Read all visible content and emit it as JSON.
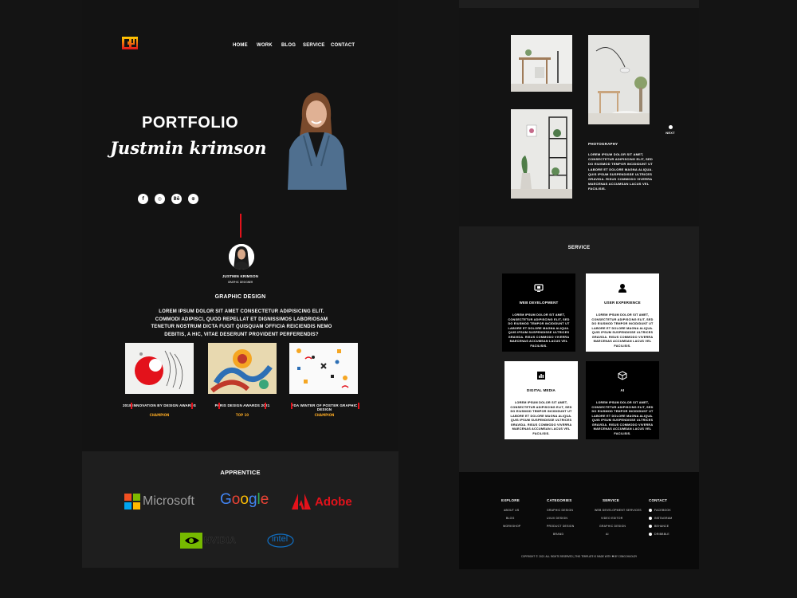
{
  "nav": {
    "home": "HOME",
    "work": "WORK",
    "blog": "BLOG",
    "service": "SERVICE",
    "contact": "CONTACT"
  },
  "hero": {
    "title": "PORTFOLIO",
    "name": "Justmin krimson"
  },
  "profile": {
    "name": "JUSTMIN KRIMSON",
    "role": "GRAPHIC DESIGNER"
  },
  "graphic_design": {
    "title": "GRAPHIC DESIGN",
    "para": "LOREM IPSUM DOLOR SIT AMET CONSECTETUR ADIPISICING ELIT. COMMODI ADIPISCI, QUOD REPELLAT ET DIGNISSIMOS LABORIOSAM TENETUR NOSTRUM DICTA FUGIT QUISQUAM OFFICIA REICIENDIS NEMO DEBITIS, A HIC, VITAE DESERUNT PROVIDENT PERFERENDIS?"
  },
  "awards": [
    {
      "title": "2018 INNOVATION BY DESIGN AWARDS",
      "result": "CHAMPION"
    },
    {
      "title": "PARIS DESIGN AWARDS 2021",
      "result": "TOP 10"
    },
    {
      "title": "FDA WINTER OF POSTER GRAPHIC DESIGN",
      "result": "CHAMPION"
    }
  ],
  "apprentice": {
    "title": "APPRENTICE",
    "brands": [
      "Microsoft",
      "Google",
      "Adobe",
      "NVIDIA",
      "intel"
    ]
  },
  "photography": {
    "title": "PHOTOGRAPHY",
    "para": "LOREM IPSUM DOLOR SIT AMET, CONSECTETUR ADIPISCING ELIT, SED DO EIUSMOD TEMPOR INCIDIDUNT UT LABORE ET DOLORE MAGNA ALIQUA. QUIS IPSUM SUSPENDISSE ULTRICES GRAVIDA. RISUS COMMODO VIVERRA MAECENAS ACCUMSAN LACUS VEL FACILISIS.",
    "next": "NEXT"
  },
  "service": {
    "title": "SERVICE",
    "items": [
      {
        "title": "WEB DEVELOPMENT",
        "icon": "monitor-icon"
      },
      {
        "title": "USER EXPERIENCE",
        "icon": "user-icon"
      },
      {
        "title": "DIGITAL MEDIA",
        "icon": "bar-chart-icon"
      },
      {
        "title": "AI",
        "icon": "cube-icon"
      }
    ],
    "para": "LOREM IPSUM DOLOR SIT AMET, CONSECTETUR ADIPISCING ELIT, SED DO EIUSMOD TEMPOR INCIDIDUNT UT LABORE ET DOLORE MAGNA ALIQUA. QUIS IPSUM SUSPENDISSE ULTRICES GRAVIDA. RISUS COMMODO VIVERRA MAECENAS ACCUMSAN LACUS VEL FACILISIS."
  },
  "footer": {
    "explore": {
      "heading": "EXPLORE",
      "items": [
        "ABOUT US",
        "BLOG",
        "WORKSHOP"
      ]
    },
    "categories": {
      "heading": "CATEGORIES",
      "items": [
        "GRAPHIC DESIGN",
        "UI/UX DESIGN",
        "PRODUCT DESIGN",
        "BRAND"
      ]
    },
    "service": {
      "heading": "SERVICE",
      "items": [
        "WEB DEVELOPMENT SERVICES",
        "VIDEO EDITOR",
        "GRAPHIC DESIGN",
        "AI"
      ]
    },
    "contact": {
      "heading": "CONTACT",
      "items": [
        "FACEBOOK",
        "INSTAGRAM",
        "BEHANCE",
        "DRIBBBLE"
      ]
    },
    "copyright": "COPYRIGHT © 2021 ALL RIGHTS RESERVED | THIS TEMPLATE IS MADE WITH ♥ BY CONGCHUOLDY"
  },
  "colors": {
    "accent": "#e3121b",
    "gold": "#f5a623",
    "bg": "#141414"
  }
}
